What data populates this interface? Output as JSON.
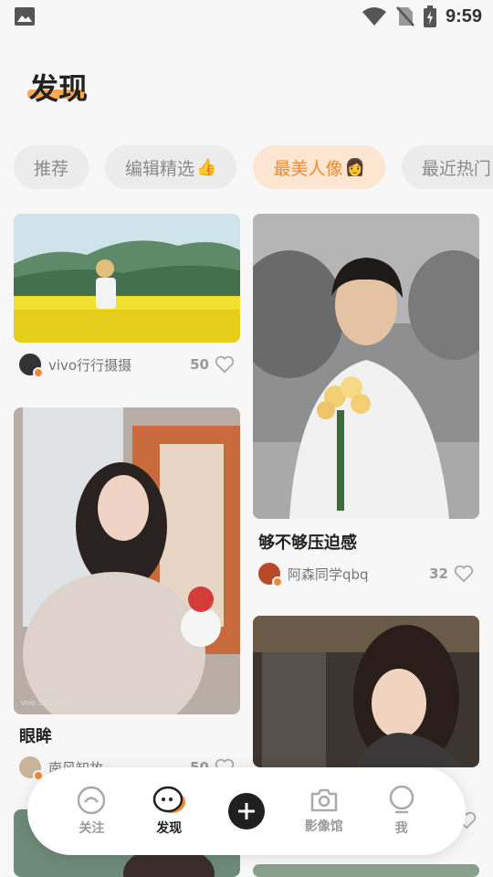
{
  "status_bar": {
    "time": "9:59"
  },
  "page": {
    "title": "发现"
  },
  "tabs": [
    {
      "label": "推荐",
      "emoji": "",
      "active": false
    },
    {
      "label": "编辑精选",
      "emoji": "👍",
      "active": false
    },
    {
      "label": "最美人像",
      "emoji": "👩",
      "active": true
    },
    {
      "label": "最近热门",
      "emoji": "",
      "active": false
    }
  ],
  "feed": {
    "left": [
      {
        "title": "",
        "author": "vivo行行摄摄",
        "likes": "50"
      },
      {
        "title": "眼眸",
        "author": "南风知故",
        "likes": "50",
        "watermark": "vivo S12 Pro"
      }
    ],
    "right": [
      {
        "title": "够不够压迫感",
        "author": "阿森同学qbq",
        "likes": "32"
      },
      {
        "title": "",
        "author": "",
        "likes": ""
      }
    ]
  },
  "bottom_nav": {
    "items": [
      {
        "label": "关注",
        "icon": "follow-icon",
        "active": false
      },
      {
        "label": "发现",
        "icon": "discover-icon",
        "active": true
      },
      {
        "label": "",
        "icon": "plus-icon",
        "active": false
      },
      {
        "label": "影像馆",
        "icon": "camera-icon",
        "active": false
      },
      {
        "label": "我",
        "icon": "profile-icon",
        "active": false
      }
    ]
  },
  "colors": {
    "accent": "#f08a32",
    "chip_bg": "#ececec",
    "active_chip_bg": "#fde6d1"
  }
}
